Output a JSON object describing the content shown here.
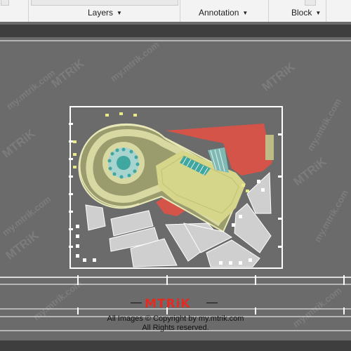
{
  "ribbon": {
    "panels": [
      {
        "label": "Layers"
      },
      {
        "label": "Annotation"
      },
      {
        "label": "Block"
      }
    ],
    "dropdown_icon": "chevron-down-icon"
  },
  "watermark": {
    "brand": "MTRiK",
    "url": "my.mtrik.com"
  },
  "footer": {
    "logo": "MTRiK",
    "copyright": "All Images © Copyright by my.mtrik.com",
    "rights": "All Rights reserved."
  },
  "colors": {
    "canvas": "#6b6b6b",
    "ribbon": "#f3f3f3",
    "building_red": "#d4544a",
    "ramp_olive": "#9a9c6e",
    "ramp_yellow": "#d6d68a",
    "plaza_teal": "#3fa6a0",
    "parking_grey": "#cfcfcf",
    "logo_red": "#e32b22"
  }
}
